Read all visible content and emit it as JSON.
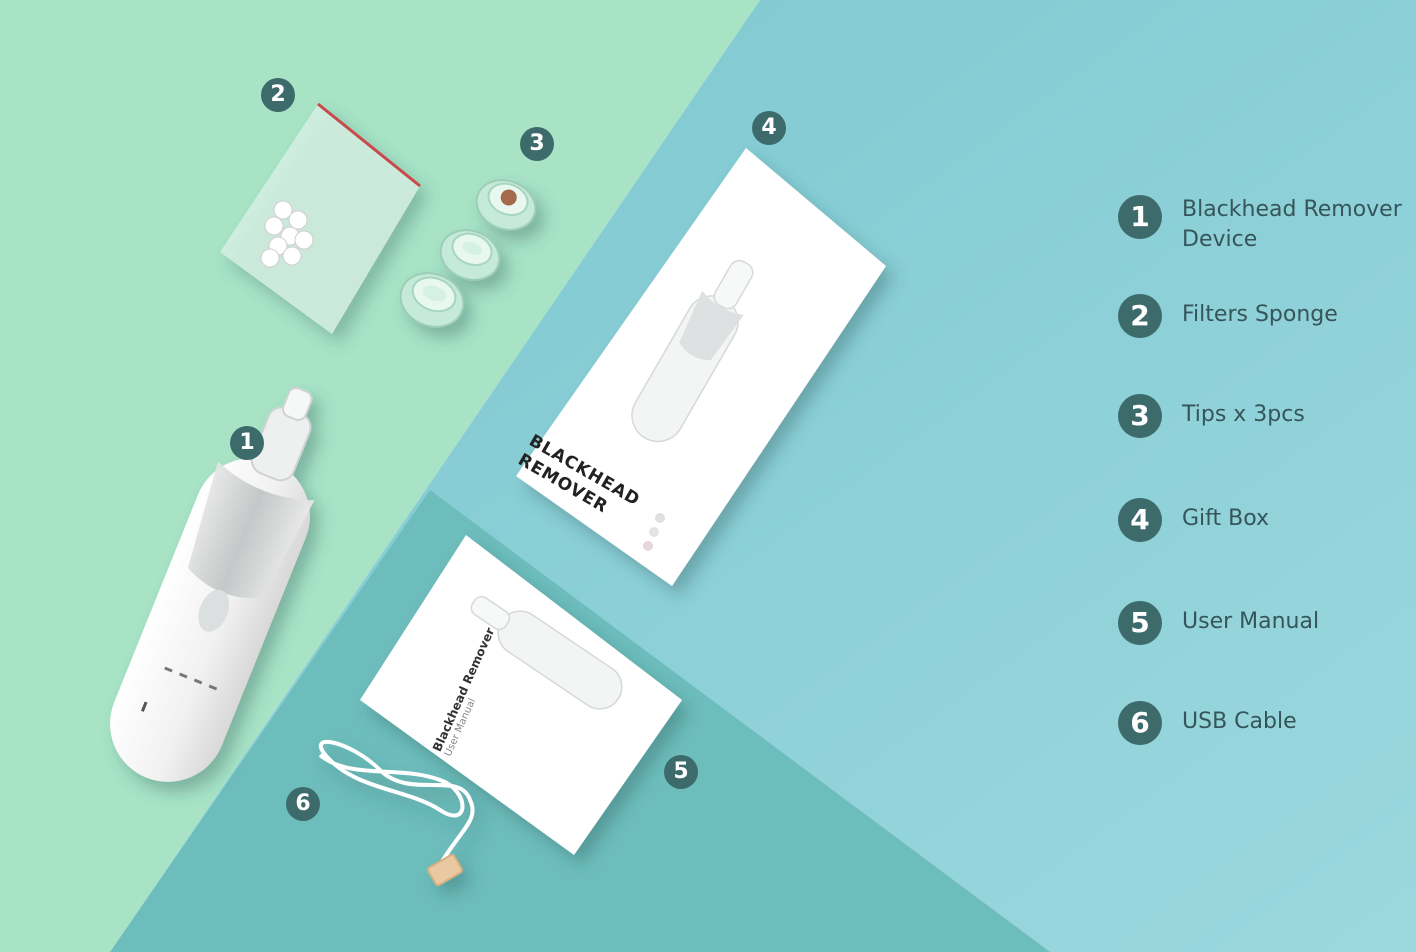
{
  "colors": {
    "green_panel": "#a8e3c6",
    "teal_panel": "#8fd2d8",
    "dark_teal_panel": "#6dbdbc",
    "badge": "#3d6b6b",
    "label_text": "#35555a"
  },
  "items_legend": [
    {
      "number": "1",
      "label": "Blackhead Remover Device"
    },
    {
      "number": "2",
      "label": "Filters Sponge"
    },
    {
      "number": "3",
      "label": "Tips x 3pcs"
    },
    {
      "number": "4",
      "label": "Gift Box"
    },
    {
      "number": "5",
      "label": "User Manual"
    },
    {
      "number": "6",
      "label": "USB Cable"
    }
  ],
  "product_badges": [
    "1",
    "2",
    "3",
    "4",
    "5",
    "6"
  ],
  "gift_box": {
    "title_line1": "BLACKHEAD",
    "title_line2": "REMOVER"
  },
  "user_manual": {
    "title": "Blackhead Remover",
    "subtitle": "User Manual"
  }
}
